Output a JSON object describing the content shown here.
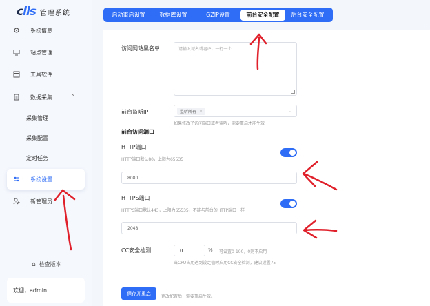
{
  "app": {
    "logo_mark_a": "c",
    "logo_mark_b": "lls",
    "title": "管理系统"
  },
  "sidebar": {
    "items": [
      {
        "label": "系统信息"
      },
      {
        "label": "站点管理"
      },
      {
        "label": "工具软件"
      },
      {
        "label": "数据采集"
      },
      {
        "label": "采集管理"
      },
      {
        "label": "采集配置"
      },
      {
        "label": "定时任务"
      },
      {
        "label": "系统设置"
      },
      {
        "label": "新管理员"
      }
    ],
    "update_label": "检查版本",
    "user_label": "欢迎，admin"
  },
  "tabs": [
    {
      "label": "启动重启设置"
    },
    {
      "label": "数据库设置"
    },
    {
      "label": "GZIP设置"
    },
    {
      "label": "前台安全配置"
    },
    {
      "label": "后台安全配置"
    }
  ],
  "form": {
    "whitelist_label": "访问网站黑名单",
    "whitelist_placeholder": "请输入域名或者IP，一行一个",
    "listen_ip_label": "前台监听IP",
    "listen_ip_tag": "监听所有",
    "listen_ip_help": "如果修改了访问端口或者监听，需要重启才能生效",
    "port_section_title": "前台访问端口",
    "http_label": "HTTP端口",
    "http_help": "HTTP端口默认80，上限为65535",
    "http_value": "8080",
    "https_label": "HTTPS端口",
    "https_help": "HTTPS端口默认443，上限为65535，不能与前台的HTTP端口一样",
    "https_value": "2048",
    "cc_label": "CC安全检测",
    "cc_value": "0",
    "cc_unit": "%",
    "cc_help_inline": "可设置0-100，0则不启用",
    "cc_help": "当CPU占用达到设定值时启用CC安全检测，建议设置75",
    "save_label": "保存并重启",
    "save_help": "更改配置后，需要重启生效。"
  },
  "colors": {
    "accent": "#2f6df6",
    "annotation": "#e0202a"
  }
}
